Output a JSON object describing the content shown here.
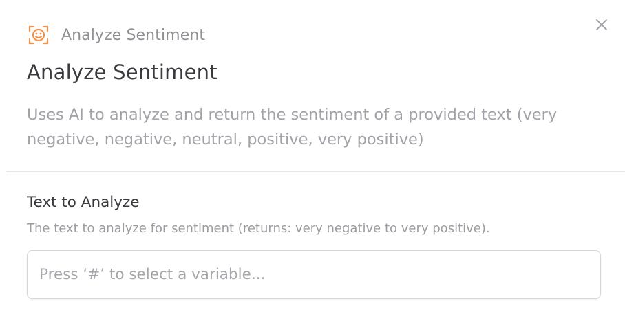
{
  "header": {
    "icon": "smiley-face-scan-icon",
    "node_type": "Analyze Sentiment",
    "close_icon": "close-icon"
  },
  "title": "Analyze Sentiment",
  "description": "Uses AI to analyze and return the sentiment of a provided text (very negative, negative, neutral, positive, very positive)",
  "field": {
    "label": "Text to Analyze",
    "help": "The text to analyze for sentiment (returns: very negative to very positive).",
    "value": "",
    "placeholder": "Press ‘#’ to select a variable..."
  },
  "colors": {
    "accent": "#f5924a",
    "title": "#3a3a3f",
    "muted": "#a2a2a8",
    "border": "#d6d6da"
  }
}
